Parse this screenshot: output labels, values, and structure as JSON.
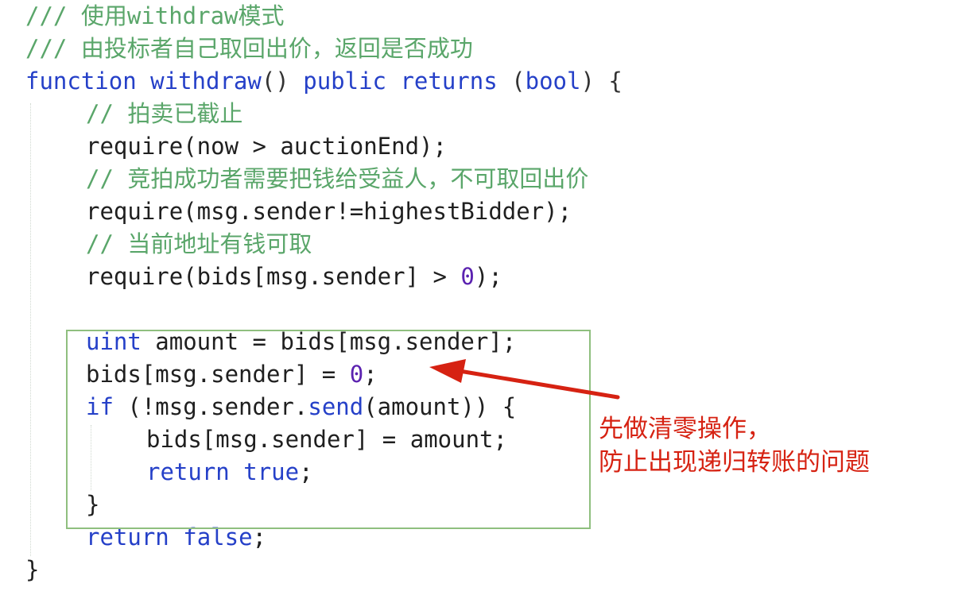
{
  "code": {
    "lines": [
      {
        "indent": 0,
        "tokens": [
          {
            "t": "/// 使用withdraw模式",
            "k": "comment"
          }
        ]
      },
      {
        "indent": 0,
        "tokens": [
          {
            "t": "/// 由投标者自己取回出价，返回是否成功",
            "k": "comment"
          }
        ]
      },
      {
        "indent": 0,
        "tokens": [
          {
            "t": "function",
            "k": "keyword"
          },
          {
            "t": " ",
            "k": "punct"
          },
          {
            "t": "withdraw",
            "k": "keyword"
          },
          {
            "t": "() ",
            "k": "punct"
          },
          {
            "t": "public",
            "k": "keyword"
          },
          {
            "t": " ",
            "k": "punct"
          },
          {
            "t": "returns",
            "k": "keyword"
          },
          {
            "t": " (",
            "k": "punct"
          },
          {
            "t": "bool",
            "k": "keyword"
          },
          {
            "t": ") {",
            "k": "punct"
          }
        ]
      },
      {
        "indent": 1,
        "tokens": [
          {
            "t": "// 拍卖已截止",
            "k": "comment"
          }
        ]
      },
      {
        "indent": 1,
        "tokens": [
          {
            "t": "require(now > auctionEnd);",
            "k": "ident"
          }
        ]
      },
      {
        "indent": 1,
        "tokens": [
          {
            "t": "// 竞拍成功者需要把钱给受益人，不可取回出价",
            "k": "comment"
          }
        ]
      },
      {
        "indent": 1,
        "tokens": [
          {
            "t": "require(msg.sender!=highestBidder);",
            "k": "ident"
          }
        ]
      },
      {
        "indent": 1,
        "tokens": [
          {
            "t": "// 当前地址有钱可取",
            "k": "comment"
          }
        ]
      },
      {
        "indent": 1,
        "tokens": [
          {
            "t": "require(bids[msg.sender] > ",
            "k": "ident"
          },
          {
            "t": "0",
            "k": "number"
          },
          {
            "t": ");",
            "k": "ident"
          }
        ]
      },
      {
        "indent": 1,
        "tokens": []
      },
      {
        "indent": 1,
        "tokens": [
          {
            "t": "uint",
            "k": "keyword"
          },
          {
            "t": " amount = bids[msg.sender];",
            "k": "ident"
          }
        ]
      },
      {
        "indent": 1,
        "tokens": [
          {
            "t": "bids[msg.sender] = ",
            "k": "ident"
          },
          {
            "t": "0",
            "k": "number"
          },
          {
            "t": ";",
            "k": "ident"
          }
        ]
      },
      {
        "indent": 1,
        "tokens": [
          {
            "t": "if",
            "k": "keyword"
          },
          {
            "t": " (!msg.sender.",
            "k": "ident"
          },
          {
            "t": "send",
            "k": "keyword"
          },
          {
            "t": "(amount)) {",
            "k": "ident"
          }
        ]
      },
      {
        "indent": 2,
        "tokens": [
          {
            "t": "bids[msg.sender] = amount;",
            "k": "ident"
          }
        ]
      },
      {
        "indent": 2,
        "tokens": [
          {
            "t": "return",
            "k": "keyword"
          },
          {
            "t": " ",
            "k": "punct"
          },
          {
            "t": "true",
            "k": "keyword"
          },
          {
            "t": ";",
            "k": "ident"
          }
        ]
      },
      {
        "indent": 1,
        "tokens": [
          {
            "t": "}",
            "k": "ident"
          }
        ]
      },
      {
        "indent": 1,
        "tokens": [
          {
            "t": "return",
            "k": "keyword"
          },
          {
            "t": " ",
            "k": "punct"
          },
          {
            "t": "false",
            "k": "keyword"
          },
          {
            "t": ";",
            "k": "ident"
          }
        ]
      },
      {
        "indent": 0,
        "tokens": [
          {
            "t": "}",
            "k": "ident"
          }
        ]
      }
    ]
  },
  "annotation": {
    "line1": "先做清零操作，",
    "line2": "防止出现递归转账的问题"
  },
  "colors": {
    "comment": "#5aa66a",
    "keyword": "#2540c8",
    "number": "#5b22b0",
    "annotation": "#d62212",
    "highlight_box": "#8fbf7f"
  }
}
